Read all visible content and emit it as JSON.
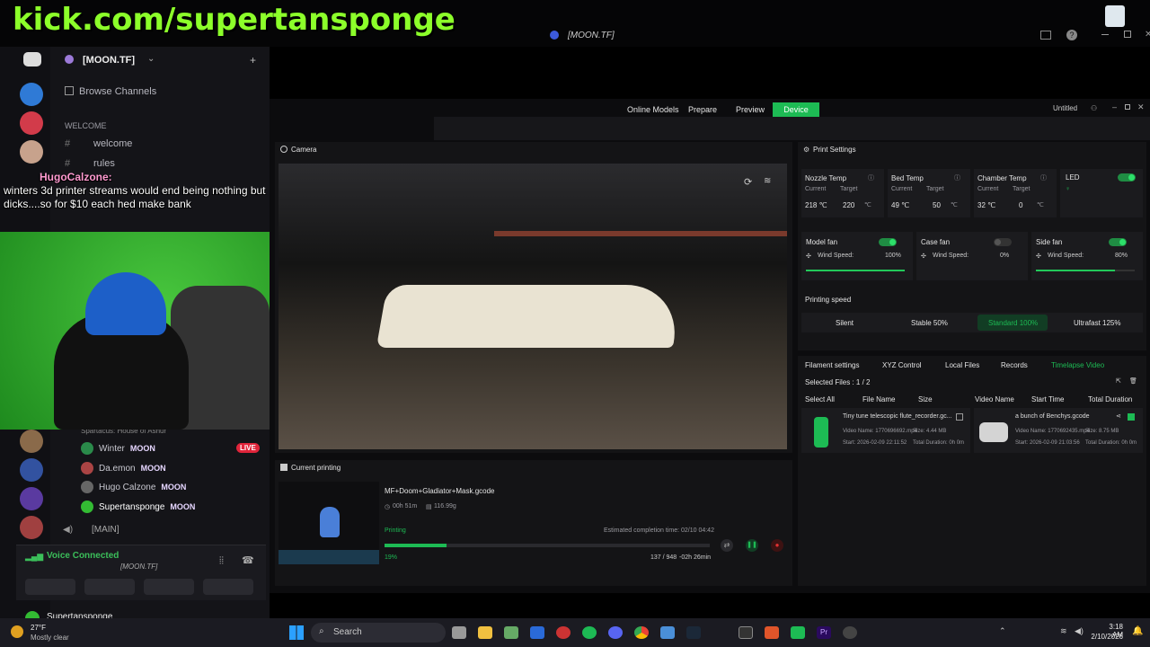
{
  "overlay": {
    "banner": "kick.com/supertansponge"
  },
  "window": {
    "title": "[MOON.TF]"
  },
  "discord": {
    "server_name": "[MOON.TF]",
    "browse_channels": "Browse Channels",
    "category_welcome": "WELCOME",
    "channels": [
      "welcome",
      "rules"
    ],
    "members": [
      {
        "name": "Winter",
        "tag": "MOON",
        "live": "LIVE"
      },
      {
        "name": "Da.emon",
        "tag": "MOON"
      },
      {
        "name": "Hugo Calzone",
        "tag": "MOON"
      },
      {
        "name": "Supertansponge",
        "tag": "MOON"
      }
    ],
    "activity": "Spartacus: House of Ashur",
    "voice_channel": "[MAIN]",
    "voice_status": "Voice Connected",
    "voice_server": "[MOON.TF]",
    "user": "Supertansponge"
  },
  "chat": {
    "author": "HugoCalzone:",
    "message": "winters 3d printer streams would end being nothing but dicks....so for $10 each hed make bank"
  },
  "app": {
    "tabs": [
      "Online Models",
      "Prepare",
      "Preview",
      "Device"
    ],
    "active_tab": "Device",
    "doc_title": "Untitled",
    "camera_title": "Camera",
    "print_settings_title": "Print Settings",
    "temps": [
      {
        "label": "Nozzle Temp",
        "current": "218 ℃",
        "target": "220",
        "unit": "℃"
      },
      {
        "label": "Bed Temp",
        "current": "49 ℃",
        "target": "50",
        "unit": "℃"
      },
      {
        "label": "Chamber Temp",
        "current": "32 ℃",
        "target": "0",
        "unit": "℃"
      }
    ],
    "current_label": "Current",
    "target_label": "Target",
    "led_label": "LED",
    "fans": [
      {
        "label": "Model fan",
        "speed_label": "Wind Speed:",
        "value": "100%",
        "level": 1.0,
        "on": true
      },
      {
        "label": "Case fan",
        "speed_label": "Wind Speed:",
        "value": "0%",
        "level": 0.0,
        "on": false
      },
      {
        "label": "Side fan",
        "speed_label": "Wind Speed:",
        "value": "80%",
        "level": 0.8,
        "on": true
      }
    ],
    "printing_speed_label": "Printing speed",
    "speeds": [
      "Silent",
      "Stable 50%",
      "Standard 100%",
      "Ultrafast 125%"
    ],
    "active_speed": "Standard 100%",
    "file_tabs": [
      "Filament settings",
      "XYZ Control",
      "Local Files",
      "Records",
      "Timelapse Video"
    ],
    "active_file_tab": "Timelapse Video",
    "selected_files": "Selected Files : 1 / 2",
    "columns": [
      "Select All",
      "File Name",
      "Size",
      "Video Name",
      "Start Time",
      "Total Duration"
    ],
    "timelapses": [
      {
        "title": "Tiny tune telescopic flute_recorder.gc...",
        "video": "Video Name: 1770696692.mp4",
        "size": "Size: 4.44 MB",
        "start": "Start: 2026-02-09 22:11:52",
        "duration": "Total Duration: 0h 0m"
      },
      {
        "title": "a bunch of Benchys.gcode",
        "video": "Video Name: 1770692435.mp4",
        "size": "Size: 8.75 MB",
        "start": "Start: 2026-02-09 21:03:56",
        "duration": "Total Duration: 0h 0m"
      }
    ],
    "current_printing_title": "Current printing",
    "job": {
      "file": "MF+Doom+Gladiator+Mask.gcode",
      "elapsed": "00h 51m",
      "weight": "116.99g",
      "status": "Printing",
      "eta": "Estimated completion time: 02/10 04:42",
      "percent_text": "19%",
      "progress": 0.19,
      "layers": "137 / 948",
      "remaining": "-02h 26min"
    }
  },
  "taskbar": {
    "weather_temp": "27°F",
    "weather_desc": "Mostly clear",
    "search": "Search",
    "time": "3:18 AM",
    "date": "2/10/2026"
  }
}
